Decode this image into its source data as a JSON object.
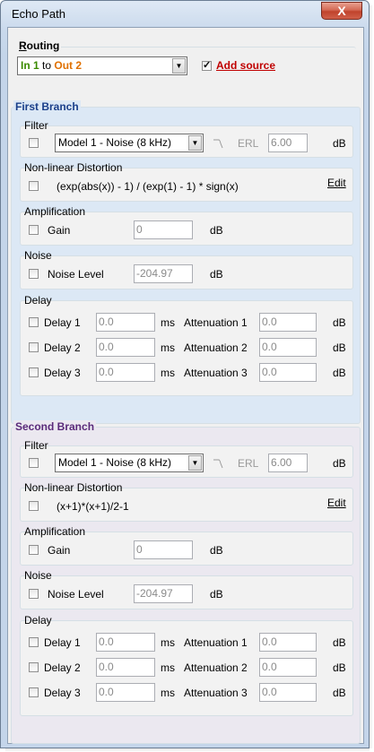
{
  "window": {
    "title": "Echo Path",
    "close_glyph": "X"
  },
  "routing": {
    "label": "Routing",
    "in_label": "In 1",
    "to_word": "to",
    "out_label": "Out 2",
    "add_source_label": "Add source",
    "add_source_checked": true,
    "colors": {
      "in": "#3a8a00",
      "out": "#e07000",
      "add_source": "#c00000"
    }
  },
  "branches": [
    {
      "title": "First Branch",
      "filter": {
        "label": "Filter",
        "model": "Model 1 - Noise (8 kHz)",
        "erl_label": "ERL",
        "erl_value": "6.00",
        "unit": "dB"
      },
      "distortion": {
        "label": "Non-linear Distortion",
        "formula": "(exp(abs(x)) - 1) / (exp(1) - 1) * sign(x)",
        "edit_label": "Edit"
      },
      "amplification": {
        "label": "Amplification",
        "gain_label": "Gain",
        "gain_value": "0",
        "unit": "dB"
      },
      "noise": {
        "label": "Noise",
        "level_label": "Noise Level",
        "level_value": "-204.97",
        "unit": "dB"
      },
      "delay": {
        "label": "Delay",
        "rows": [
          {
            "delay_label": "Delay 1",
            "delay_value": "0.0",
            "ms": "ms",
            "att_label": "Attenuation 1",
            "att_value": "0.0",
            "unit": "dB"
          },
          {
            "delay_label": "Delay 2",
            "delay_value": "0.0",
            "ms": "ms",
            "att_label": "Attenuation 2",
            "att_value": "0.0",
            "unit": "dB"
          },
          {
            "delay_label": "Delay 3",
            "delay_value": "0.0",
            "ms": "ms",
            "att_label": "Attenuation 3",
            "att_value": "0.0",
            "unit": "dB"
          }
        ]
      },
      "colors": {
        "title": "#1a3f8a",
        "background": "#dce8f5"
      }
    },
    {
      "title": "Second Branch",
      "filter": {
        "label": "Filter",
        "model": "Model 1 - Noise (8 kHz)",
        "erl_label": "ERL",
        "erl_value": "6.00",
        "unit": "dB"
      },
      "distortion": {
        "label": "Non-linear Distortion",
        "formula": "(x+1)*(x+1)/2-1",
        "edit_label": "Edit"
      },
      "amplification": {
        "label": "Amplification",
        "gain_label": "Gain",
        "gain_value": "0",
        "unit": "dB"
      },
      "noise": {
        "label": "Noise",
        "level_label": "Noise Level",
        "level_value": "-204.97",
        "unit": "dB"
      },
      "delay": {
        "label": "Delay",
        "rows": [
          {
            "delay_label": "Delay 1",
            "delay_value": "0.0",
            "ms": "ms",
            "att_label": "Attenuation 1",
            "att_value": "0.0",
            "unit": "dB"
          },
          {
            "delay_label": "Delay 2",
            "delay_value": "0.0",
            "ms": "ms",
            "att_label": "Attenuation 2",
            "att_value": "0.0",
            "unit": "dB"
          },
          {
            "delay_label": "Delay 3",
            "delay_value": "0.0",
            "ms": "ms",
            "att_label": "Attenuation 3",
            "att_value": "0.0",
            "unit": "dB"
          }
        ]
      },
      "colors": {
        "title": "#5a2a7a",
        "background": "#ebe8f0"
      }
    }
  ]
}
